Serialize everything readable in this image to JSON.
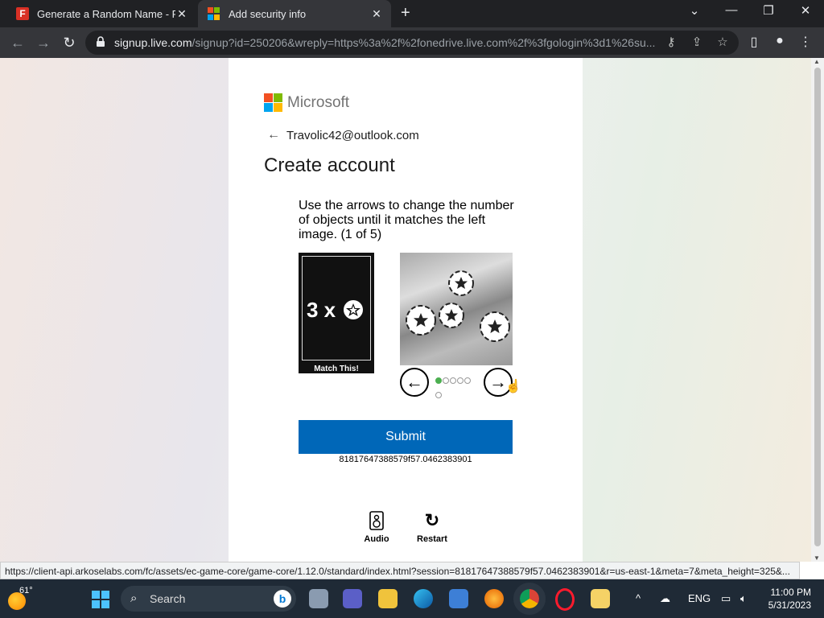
{
  "browser": {
    "tabs": [
      {
        "title": "Generate a Random Name - Fake",
        "icon": "fakename-f-icon",
        "active": false
      },
      {
        "title": "Add security info",
        "icon": "microsoft-icon",
        "active": true
      }
    ],
    "url_domain": "signup.live.com",
    "url_path": "/signup?id=250206&wreply=https%3a%2f%2fonedrive.live.com%2f%3fgologin%3d1%26su..."
  },
  "page": {
    "brand": "Microsoft",
    "email": "Travolic42@outlook.com",
    "title": "Create account",
    "puzzle": {
      "instructions": "Use the arrows to change the number of objects until it matches the left image. (1 of 5)",
      "target_count": "3 x",
      "match_label": "Match This!",
      "step": 1,
      "steps_total": 5,
      "prev_glyph": "←",
      "next_glyph": "→"
    },
    "submit_label": "Submit",
    "session_id": "81817647388579f57.0462383901",
    "audio_label": "Audio",
    "restart_label": "Restart"
  },
  "status_url": "https://client-api.arkoselabs.com/fc/assets/ec-game-core/game-core/1.12.0/standard/index.html?session=81817647388579f57.0462383901&r=us-east-1&meta=7&meta_height=325&...",
  "taskbar": {
    "temperature": "61°",
    "search_label": "Search",
    "language": "ENG",
    "time": "11:00 PM",
    "date": "5/31/2023"
  },
  "colors": {
    "submit_bg": "#0067b8",
    "ms_red": "#f25022",
    "ms_green": "#7fba00",
    "ms_blue": "#00a4ef",
    "ms_yellow": "#ffb900"
  }
}
